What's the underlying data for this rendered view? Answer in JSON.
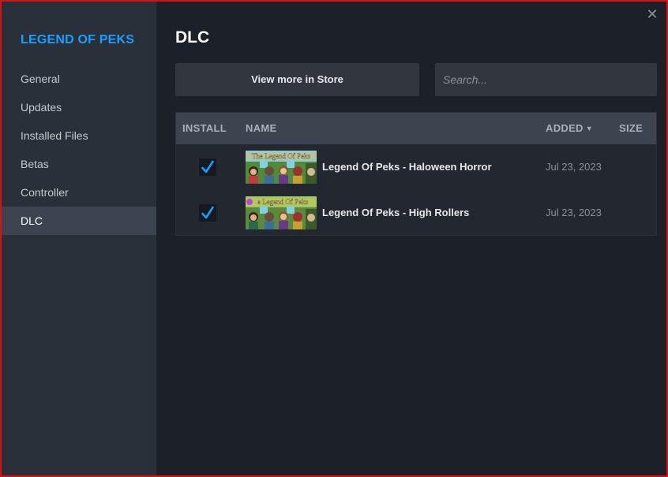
{
  "sidebar": {
    "game_title": "LEGEND OF PEKS",
    "items": [
      {
        "label": "General"
      },
      {
        "label": "Updates"
      },
      {
        "label": "Installed Files"
      },
      {
        "label": "Betas"
      },
      {
        "label": "Controller"
      },
      {
        "label": "DLC",
        "active": true
      }
    ]
  },
  "main": {
    "title": "DLC",
    "store_button": "View more in Store",
    "search_placeholder": "Search...",
    "close_icon": "close-icon"
  },
  "table": {
    "columns": {
      "install": "INSTALL",
      "name": "NAME",
      "added": "ADDED",
      "size": "SIZE"
    },
    "rows": [
      {
        "installed": true,
        "name": "Legend Of Peks - Haloween Horror",
        "added": "Jul 23, 2023",
        "size": "",
        "thumb_caption": "The Legend Of Peks"
      },
      {
        "installed": true,
        "name": "Legend Of Peks - High Rollers",
        "added": "Jul 23, 2023",
        "size": "",
        "thumb_caption": "e Legend Of Peks"
      }
    ]
  },
  "colors": {
    "accent": "#1a9fff",
    "sidebar_bg": "#2a3039",
    "main_bg": "#1b2029",
    "header_bg": "#3d4450",
    "frame": "#d41414"
  }
}
